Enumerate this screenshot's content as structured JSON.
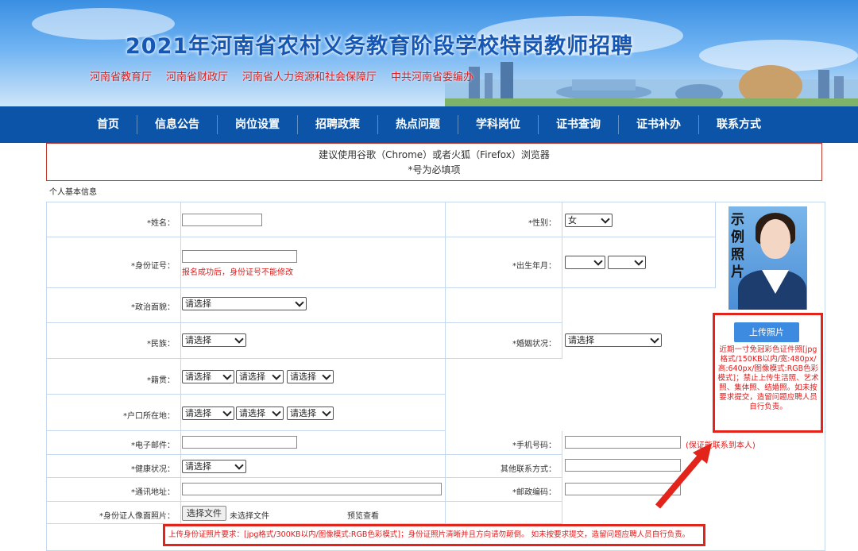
{
  "header": {
    "title": "2021年河南省农村义务教育阶段学校特岗教师招聘",
    "orgs": [
      "河南省教育厅",
      "河南省财政厅",
      "河南省人力资源和社会保障厅",
      "中共河南省委编办"
    ]
  },
  "nav": {
    "items": [
      "首页",
      "信息公告",
      "岗位设置",
      "招聘政策",
      "热点问题",
      "学科岗位",
      "证书查询",
      "证书补办",
      "联系方式"
    ]
  },
  "notice": {
    "line1": "建议使用谷歌（Chrome）或者火狐（Firefox）浏览器",
    "line2": "*号为必填项"
  },
  "section_title": "个人基本信息",
  "form": {
    "name_label": "*姓名：",
    "gender_label": "*性别：",
    "gender_value": "女",
    "id_label": "*身份证号：",
    "id_hint": "报名成功后，身份证号不能修改",
    "birth_label": "*出生年月：",
    "politics_label": "*政治面貌：",
    "politics_value": "请选择",
    "ethnic_label": "*民族：",
    "ethnic_value": "请选择",
    "marital_label": "*婚姻状况：",
    "marital_value": "请选择",
    "native_label": "*籍贯：",
    "native_values": [
      "请选择",
      "请选择",
      "请选择"
    ],
    "hukou_label": "*户口所在地：",
    "hukou_values": [
      "请选择",
      "请选择",
      "请选择"
    ],
    "email_label": "*电子邮件：",
    "phone_label": "*手机号码：",
    "phone_hint": "(保证能联系到本人)",
    "health_label": "*健康状况：",
    "health_value": "请选择",
    "other_contact_label": "其他联系方式：",
    "address_label": "*通讯地址：",
    "postcode_label": "*邮政编码：",
    "id_photo_label": "*身份证人像面照片：",
    "choose_file": "选择文件",
    "no_file": "未选择文件",
    "preview": "预览查看"
  },
  "photo": {
    "sample_text": "示例照片",
    "upload_button": "上传照片",
    "requirements": "近期一寸免冠彩色证件照[jpg格式/150KB以内/宽:480px/高:640px/图像模式:RGB色彩模式]；禁止上传生活照、艺术照、集体照、结婚照。如未按要求提交，造留问题应聘人员自行负责。"
  },
  "bottom_notice": "上传身份证照片要求：[jpg格式/300KB以内/图像模式:RGB色彩模式]；身份证照片清晰并且方向请勿颠倒。 如未按要求提交，造留问题应聘人员自行负责。",
  "colors": {
    "nav_bg": "#0c54a8",
    "title": "#1557b3",
    "alert_red": "#e3241b",
    "upload_btn": "#3d8be0"
  }
}
